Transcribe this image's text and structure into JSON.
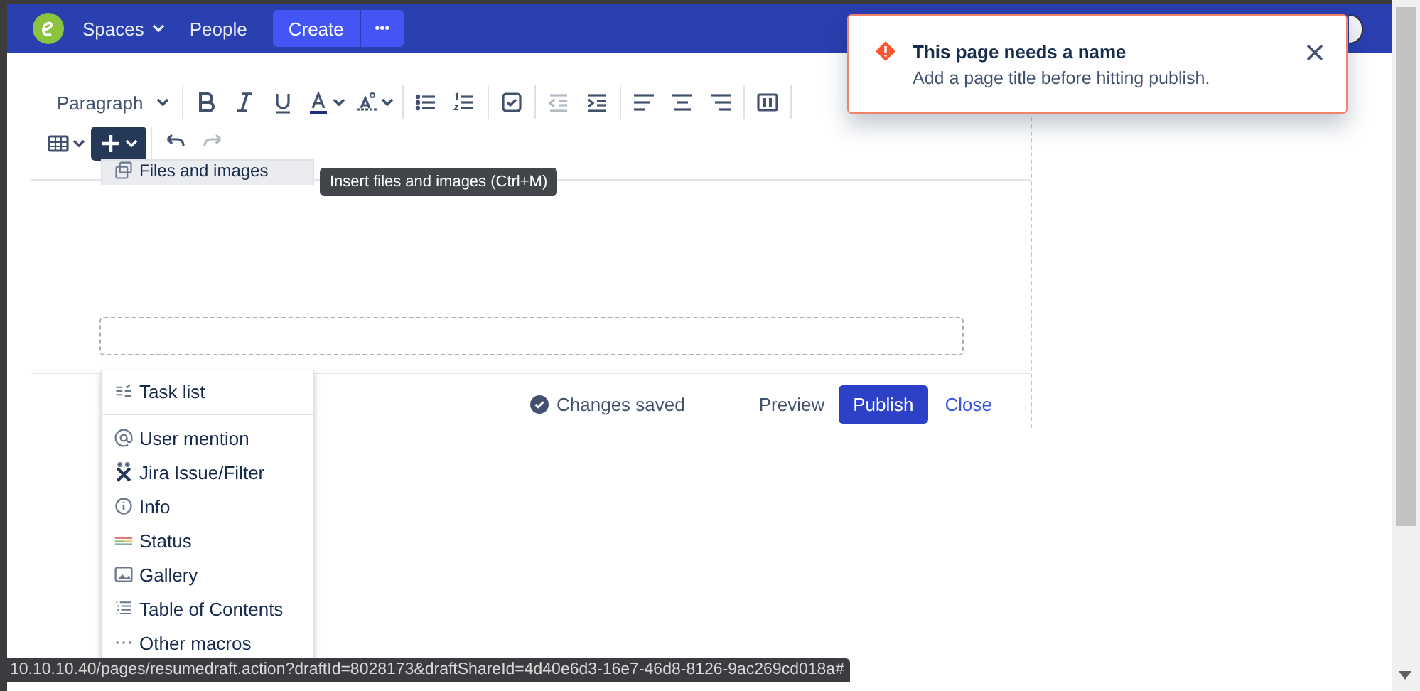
{
  "nav": {
    "items": [
      {
        "label": "Spaces",
        "dropdown": true
      },
      {
        "label": "People",
        "dropdown": false
      }
    ],
    "create": "Create",
    "more": "•••"
  },
  "toolbar": {
    "style": "Paragraph",
    "row_1": [
      {
        "kind": "bold",
        "disabled": false,
        "pressed": false
      },
      {
        "kind": "italic",
        "disabled": false,
        "pressed": false
      },
      {
        "kind": "underline",
        "disabled": false,
        "pressed": false
      },
      {
        "kind": "text-color",
        "disabled": false,
        "pressed": false
      },
      {
        "kind": "text-format",
        "disabled": false,
        "pressed": false
      },
      {
        "kind": "bullet-list",
        "disabled": false,
        "pressed": false
      },
      {
        "kind": "numbered-list",
        "disabled": false,
        "pressed": false
      },
      {
        "kind": "task",
        "disabled": false,
        "pressed": false
      },
      {
        "kind": "outdent",
        "disabled": true,
        "pressed": false
      },
      {
        "kind": "indent",
        "disabled": false,
        "pressed": false
      },
      {
        "kind": "align-left",
        "disabled": false,
        "pressed": false
      },
      {
        "kind": "align-center",
        "disabled": false,
        "pressed": false
      },
      {
        "kind": "align-right",
        "disabled": false,
        "pressed": false
      },
      {
        "kind": "layout",
        "disabled": false,
        "pressed": false
      }
    ],
    "row_2": [
      {
        "kind": "table",
        "disabled": false,
        "pressed": false
      },
      {
        "kind": "insert",
        "disabled": false,
        "pressed": true
      },
      {
        "kind": "undo",
        "disabled": false,
        "pressed": false
      },
      {
        "kind": "redo",
        "disabled": true,
        "pressed": false
      }
    ]
  },
  "insert_menu": {
    "upper_items": [
      {
        "label": "Files and images",
        "selected": true
      }
    ],
    "lower_items": [
      {
        "kind": "item",
        "label": "Task list",
        "selected": false
      },
      {
        "kind": "separator"
      },
      {
        "kind": "item",
        "label": "User mention",
        "selected": false
      },
      {
        "kind": "item",
        "label": "Jira Issue/Filter",
        "selected": false
      },
      {
        "kind": "item",
        "label": "Info",
        "selected": false
      },
      {
        "kind": "item",
        "label": "Status",
        "selected": false
      },
      {
        "kind": "item",
        "label": "Gallery",
        "selected": false
      },
      {
        "kind": "item",
        "label": "Table of Contents",
        "selected": false
      },
      {
        "kind": "item",
        "label": "Other macros",
        "selected": false
      }
    ]
  },
  "tooltip": "Insert files and images (Ctrl+M)",
  "footer": {
    "status": "Changes saved",
    "preview": "Preview",
    "publish": "Publish",
    "close": "Close"
  },
  "flag": {
    "title": "This page needs a name",
    "message": "Add a page title before hitting publish."
  },
  "status_bar": "10.10.10.40/pages/resumedraft.action?draftId=8028173&draftShareId=4d40e6d3-16e7-46d8-8126-9ac269cd018a#"
}
